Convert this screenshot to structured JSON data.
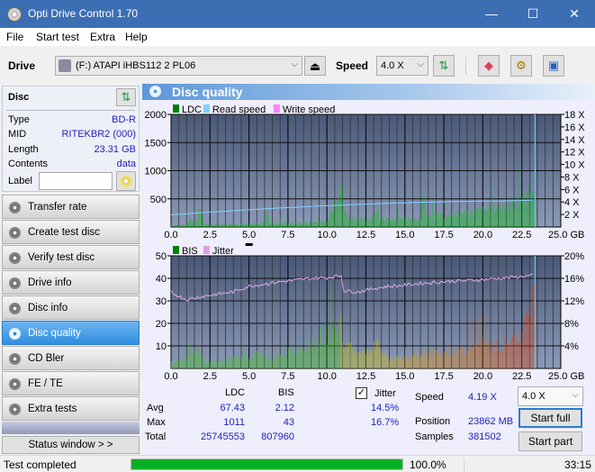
{
  "window": {
    "title": "Opti Drive Control 1.70",
    "minimize": "—",
    "maximize": "☐",
    "close": "✕"
  },
  "menu": [
    "File",
    "Start test",
    "Extra",
    "Help"
  ],
  "toolbar": {
    "drive_label": "Drive",
    "drive_value": "(F:)  ATAPI iHBS112  2 PL06",
    "speed_label": "Speed",
    "speed_value": "4.0 X"
  },
  "disc": {
    "header": "Disc",
    "rows": [
      {
        "label": "Type",
        "value": "BD-R"
      },
      {
        "label": "MID",
        "value": "RITEKBR2 (000)"
      },
      {
        "label": "Length",
        "value": "23.31 GB"
      },
      {
        "label": "Contents",
        "value": "data"
      }
    ],
    "label_field": "Label",
    "label_value": ""
  },
  "nav": [
    {
      "label": "Transfer rate",
      "active": false
    },
    {
      "label": "Create test disc",
      "active": false
    },
    {
      "label": "Verify test disc",
      "active": false
    },
    {
      "label": "Drive info",
      "active": false
    },
    {
      "label": "Disc info",
      "active": false
    },
    {
      "label": "Disc quality",
      "active": true
    },
    {
      "label": "CD Bler",
      "active": false
    },
    {
      "label": "FE / TE",
      "active": false
    },
    {
      "label": "Extra tests",
      "active": false
    }
  ],
  "status_window_button": "Status window > >",
  "panel_title": "Disc quality",
  "chart_data": [
    {
      "type": "bar",
      "title": "LDC",
      "legend": [
        "LDC",
        "Read speed",
        "Write speed"
      ],
      "legend_colors": [
        "#008000",
        "#80d0ff",
        "#ff80ff"
      ],
      "xlabel": "GB",
      "x_ticks": [
        "0.0",
        "2.5",
        "5.0",
        "7.5",
        "10.0",
        "12.5",
        "15.0",
        "17.5",
        "20.0",
        "22.5",
        "25.0 GB"
      ],
      "xlim": [
        0,
        25
      ],
      "y_ticks": [
        "500",
        "1000",
        "1500",
        "2000"
      ],
      "ylim": [
        0,
        2000
      ],
      "y2_ticks": [
        "2 X",
        "4 X",
        "6 X",
        "8 X",
        "10 X",
        "12 X",
        "14 X",
        "16 X",
        "18 X"
      ],
      "y2lim": [
        0,
        18
      ],
      "ldc_profile": [
        [
          0,
          40
        ],
        [
          1,
          50
        ],
        [
          1.2,
          300
        ],
        [
          1.4,
          60
        ],
        [
          1.9,
          420
        ],
        [
          2.1,
          60
        ],
        [
          4,
          60
        ],
        [
          6,
          80
        ],
        [
          6.1,
          470
        ],
        [
          6.3,
          80
        ],
        [
          8,
          90
        ],
        [
          10,
          110
        ],
        [
          10.9,
          1011
        ],
        [
          11.1,
          300
        ],
        [
          11.5,
          200
        ],
        [
          12.5,
          160
        ],
        [
          13,
          250
        ],
        [
          14,
          150
        ],
        [
          15,
          180
        ],
        [
          16,
          200
        ],
        [
          16.2,
          820
        ],
        [
          16.4,
          220
        ],
        [
          18,
          280
        ],
        [
          20,
          350
        ],
        [
          21,
          420
        ],
        [
          22,
          520
        ],
        [
          22.8,
          650
        ],
        [
          23.3,
          900
        ],
        [
          23.31,
          0
        ]
      ],
      "read_speed": [
        [
          0,
          1.95
        ],
        [
          1,
          2.1
        ],
        [
          2,
          2.3
        ],
        [
          3,
          2.45
        ],
        [
          4,
          2.6
        ],
        [
          5,
          2.75
        ],
        [
          6,
          2.9
        ],
        [
          7,
          3.05
        ],
        [
          8,
          3.15
        ],
        [
          9,
          3.3
        ],
        [
          10,
          3.4
        ],
        [
          11,
          3.5
        ],
        [
          12,
          3.6
        ],
        [
          13,
          3.7
        ],
        [
          14,
          3.8
        ],
        [
          15,
          3.85
        ],
        [
          16,
          3.95
        ],
        [
          17,
          4.0
        ],
        [
          18,
          4.05
        ],
        [
          19,
          4.1
        ],
        [
          20,
          4.15
        ],
        [
          21,
          4.15
        ],
        [
          22,
          4.2
        ],
        [
          23.3,
          4.3
        ]
      ]
    },
    {
      "type": "bar",
      "title": "BIS",
      "legend": [
        "BIS",
        "Jitter"
      ],
      "legend_colors": [
        "#008000",
        "#e0a0e0"
      ],
      "xlabel": "GB",
      "x_ticks": [
        "0.0",
        "2.5",
        "5.0",
        "7.5",
        "10.0",
        "12.5",
        "15.0",
        "17.5",
        "20.0",
        "22.5",
        "25.0 GB"
      ],
      "xlim": [
        0,
        25
      ],
      "y_ticks": [
        "10",
        "20",
        "30",
        "40",
        "50"
      ],
      "ylim": [
        0,
        50
      ],
      "y2_ticks": [
        "4%",
        "8%",
        "12%",
        "16%",
        "20%"
      ],
      "y2lim": [
        0,
        20
      ],
      "bis_profile": [
        [
          0,
          3
        ],
        [
          1.9,
          10
        ],
        [
          2.1,
          3
        ],
        [
          6,
          8
        ],
        [
          6.3,
          3
        ],
        [
          10.9,
          23
        ],
        [
          11,
          12
        ],
        [
          12.5,
          8
        ],
        [
          13,
          14
        ],
        [
          14,
          5
        ],
        [
          16,
          7
        ],
        [
          18,
          9
        ],
        [
          20,
          13
        ],
        [
          21,
          12
        ],
        [
          22,
          15
        ],
        [
          22.5,
          20
        ],
        [
          23.1,
          35
        ],
        [
          23.3,
          43
        ],
        [
          23.31,
          0
        ]
      ],
      "jitter": [
        [
          0,
          13.5
        ],
        [
          1,
          12.2
        ],
        [
          2,
          12.8
        ],
        [
          3,
          13.2
        ],
        [
          4,
          13.6
        ],
        [
          5,
          14.6
        ],
        [
          6,
          15.0
        ],
        [
          7,
          15.4
        ],
        [
          8,
          15.7
        ],
        [
          9,
          16.0
        ],
        [
          10,
          16.1
        ],
        [
          10.9,
          16.5
        ],
        [
          11.1,
          13.8
        ],
        [
          12,
          13.6
        ],
        [
          13,
          14.2
        ],
        [
          14,
          14.6
        ],
        [
          15,
          14.8
        ],
        [
          16,
          15.1
        ],
        [
          17,
          15.3
        ],
        [
          18,
          15.5
        ],
        [
          19,
          15.6
        ],
        [
          20,
          15.8
        ],
        [
          21,
          16.0
        ],
        [
          22,
          16.2
        ],
        [
          23.3,
          16.5
        ]
      ]
    }
  ],
  "stats": {
    "columns": [
      "LDC",
      "BIS"
    ],
    "rows": [
      {
        "label": "Avg",
        "ldc": "67.43",
        "bis": "2.12",
        "jitter": "14.5%"
      },
      {
        "label": "Max",
        "ldc": "1011",
        "bis": "43",
        "jitter": "16.7%"
      },
      {
        "label": "Total",
        "ldc": "25745553",
        "bis": "807960"
      }
    ],
    "jitter_label": "Jitter",
    "jitter_checked": true,
    "speed_label": "Speed",
    "speed_value": "4.19 X",
    "position_label": "Position",
    "position_value": "23862 MB",
    "samples_label": "Samples",
    "samples_value": "381502",
    "speed_select": "4.0 X",
    "start_full": "Start full",
    "start_part": "Start part"
  },
  "statusbar": {
    "text": "Test completed",
    "progress": 100.0,
    "progress_text": "100.0%",
    "time": "33:15"
  }
}
